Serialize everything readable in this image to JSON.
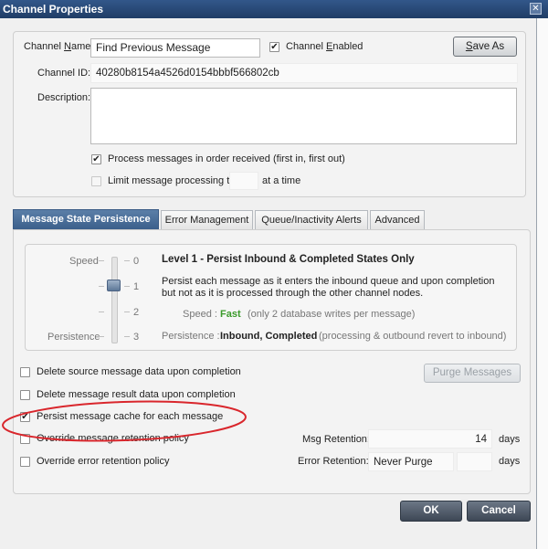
{
  "window": {
    "title": "Channel Properties",
    "close_glyph": "✕"
  },
  "channel": {
    "name_label_prefix": "Channel ",
    "name_label_underlined": "N",
    "name_label_suffix": "ame:",
    "name_value": "Find Previous Message",
    "enabled_label_prefix": "Channel ",
    "enabled_label_underlined": "E",
    "enabled_label_suffix": "nabled",
    "enabled_checked": true,
    "save_as_prefix": "",
    "save_as_underlined": "S",
    "save_as_suffix": "ave As",
    "id_label": "Channel ID:",
    "id_value": "40280b8154a4526d0154bbbf566802cb",
    "description_label": "Description:",
    "description_value": "",
    "process_order_label": "Process messages in order received (first in, first out)",
    "process_order_checked": true,
    "limit_label": "Limit message processing to",
    "limit_suffix": "at a time",
    "limit_value": "",
    "limit_checked": false
  },
  "tabs": [
    {
      "label": "Message State Persistence",
      "active": true
    },
    {
      "label": "Error Management",
      "active": false
    },
    {
      "label": "Queue/Inactivity Alerts",
      "active": false
    },
    {
      "label": "Advanced",
      "active": false
    }
  ],
  "persistence": {
    "speed_label": "Speed",
    "persistence_label": "Persistence",
    "ticks": [
      "0",
      "1",
      "2",
      "3"
    ],
    "level_value": 1,
    "level_title": "Level 1 - Persist Inbound & Completed States Only",
    "level_description": "Persist each message as it enters the inbound queue and upon completion but not as it is processed through the other channel nodes.",
    "speed_row_label": "Speed :",
    "speed_row_value": "Fast",
    "speed_row_note": "(only 2 database writes per message)",
    "persistence_row_label": "Persistence :",
    "persistence_row_value": "Inbound, Completed",
    "persistence_row_note": "(processing & outbound revert to inbound)",
    "speed_value_color": "#3a9a2a"
  },
  "options": [
    {
      "label": "Delete source message data upon completion",
      "checked": false
    },
    {
      "label": "Delete message result data upon completion",
      "checked": false
    },
    {
      "label": "Persist message cache for each message",
      "checked": true
    },
    {
      "label": "Override message retention policy",
      "checked": false
    },
    {
      "label": "Override error retention policy",
      "checked": false
    }
  ],
  "purge_button": "Purge Messages",
  "msg_retention": {
    "label": "Msg Retention:",
    "value": "14",
    "unit": "days"
  },
  "error_retention": {
    "label": "Error Retention:",
    "value": "Never Purge",
    "unit": "days"
  },
  "footer": {
    "ok": "OK",
    "cancel": "Cancel"
  },
  "annotation": {
    "color": "#d9262c"
  }
}
